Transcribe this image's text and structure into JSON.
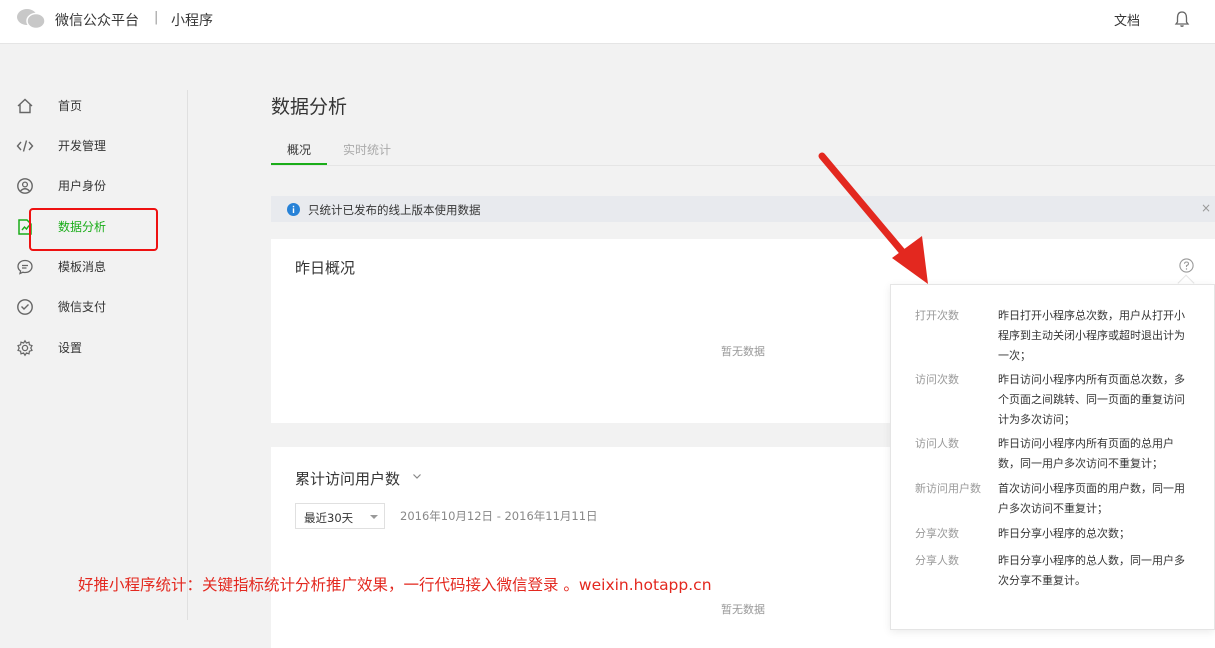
{
  "header": {
    "brand": "微信公众平台",
    "separator": "|",
    "product": "小程序",
    "docs_label": "文档"
  },
  "sidebar": {
    "items": [
      {
        "label": "首页",
        "icon": "home-icon"
      },
      {
        "label": "开发管理",
        "icon": "code-icon"
      },
      {
        "label": "用户身份",
        "icon": "user-circle-icon"
      },
      {
        "label": "数据分析",
        "icon": "data-chart-icon",
        "active": true
      },
      {
        "label": "模板消息",
        "icon": "message-icon"
      },
      {
        "label": "微信支付",
        "icon": "wechat-pay-icon"
      },
      {
        "label": "设置",
        "icon": "gear-icon"
      }
    ]
  },
  "main": {
    "title": "数据分析",
    "tabs": [
      {
        "label": "概况",
        "active": true
      },
      {
        "label": "实时统计"
      }
    ],
    "notice": "只统计已发布的线上版本使用数据",
    "notice_close": "×",
    "yesterday": {
      "title": "昨日概况",
      "empty": "暂无数据"
    },
    "cumulative": {
      "title": "累计访问用户数",
      "period": "最近30天",
      "date_range": "2016年10月12日 - 2016年11月11日",
      "empty": "暂无数据"
    }
  },
  "popover": {
    "definitions": [
      {
        "term": "打开次数",
        "desc": "昨日打开小程序总次数，用户从打开小程序到主动关闭小程序或超时退出计为一次；"
      },
      {
        "term": "访问次数",
        "desc": "昨日访问小程序内所有页面总次数，多个页面之间跳转、同一页面的重复访问计为多次访问；"
      },
      {
        "term": "访问人数",
        "desc": "昨日访问小程序内所有页面的总用户数，同一用户多次访问不重复计；"
      },
      {
        "term": "新访问用户数",
        "desc": "首次访问小程序页面的用户数，同一用户多次访问不重复计；"
      },
      {
        "term": "分享次数",
        "desc": "昨日分享小程序的总次数；"
      },
      {
        "term": "分享人数",
        "desc": "昨日分享小程序的总人数，同一用户多次分享不重复计。"
      }
    ]
  },
  "overlay": {
    "promo_text": "好推小程序统计：关键指标统计分析推广效果，一行代码接入微信登录 。weixin.hotapp.cn"
  },
  "colors": {
    "accent": "#1aad19",
    "annotation_red": "#e3281f"
  }
}
